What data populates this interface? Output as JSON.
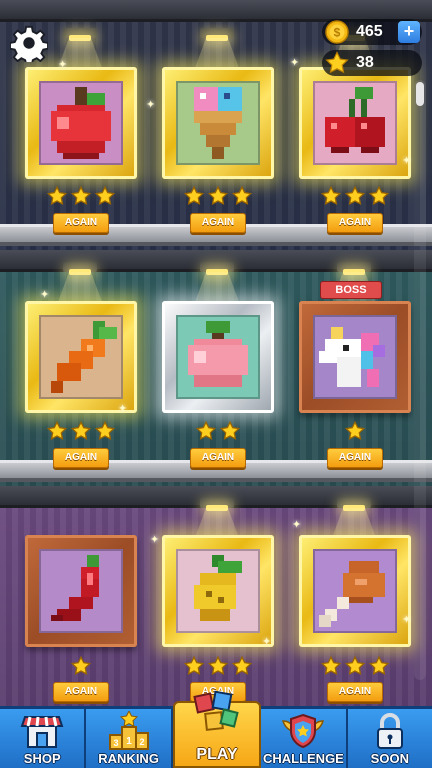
{
  "gallery": {
    "rooms": [
      {
        "name": "room-1",
        "artworks": [
          {
            "subject": "apple",
            "frame": "gold",
            "stars_earned": 3,
            "stars_max": 3,
            "button": "AGAIN",
            "canvas_bg": "#c98fc4"
          },
          {
            "subject": "ice cream",
            "frame": "gold",
            "stars_earned": 3,
            "stars_max": 3,
            "button": "AGAIN",
            "canvas_bg": "#a7c98a"
          },
          {
            "subject": "cherries",
            "frame": "gold",
            "stars_earned": 3,
            "stars_max": 3,
            "button": "AGAIN",
            "canvas_bg": "#e6a9c4"
          }
        ]
      },
      {
        "name": "room-2",
        "artworks": [
          {
            "subject": "carrot",
            "frame": "gold",
            "stars_earned": 3,
            "stars_max": 3,
            "button": "AGAIN",
            "canvas_bg": "#d9b48c"
          },
          {
            "subject": "peach",
            "frame": "silver",
            "stars_earned": 2,
            "stars_max": 2,
            "button": "AGAIN",
            "canvas_bg": "#7ccab6"
          },
          {
            "subject": "unicorn",
            "frame": "wood",
            "stars_earned": 1,
            "stars_max": 1,
            "button": "AGAIN",
            "badge": "BOSS",
            "canvas_bg": "#a586c9"
          }
        ]
      },
      {
        "name": "room-3",
        "artworks": [
          {
            "subject": "chili pepper",
            "frame": "wood",
            "stars_earned": 1,
            "stars_max": 1,
            "button": "AGAIN",
            "canvas_bg": "#b58ac9"
          },
          {
            "subject": "pineapple",
            "frame": "gold",
            "stars_earned": 3,
            "stars_max": 3,
            "button": "AGAIN",
            "canvas_bg": "#e5c1cf"
          },
          {
            "subject": "drumstick",
            "frame": "gold",
            "stars_earned": 3,
            "stars_max": 3,
            "button": "AGAIN",
            "canvas_bg": "#b28ad0"
          }
        ]
      }
    ]
  },
  "hud": {
    "settings_icon": "gear-icon",
    "coins": "465",
    "coin_icon": "dollar-coin-icon",
    "stars_total": "38",
    "star_icon": "star-icon",
    "plus_label": "+"
  },
  "nav": {
    "items": [
      {
        "label": "SHOP",
        "icon": "shop-icon",
        "active": false
      },
      {
        "label": "RANKING",
        "icon": "podium-icon",
        "active": false
      },
      {
        "label": "PLAY",
        "icon": "blocks-icon",
        "active": true
      },
      {
        "label": "CHALLENGE",
        "icon": "shield-wings-icon",
        "active": false
      },
      {
        "label": "SOON",
        "icon": "lock-icon",
        "active": false
      }
    ]
  },
  "colors": {
    "gold": "#f2c415",
    "star": "#ffcf1f",
    "again_button": "#f6a716",
    "nav": "#2a83dc",
    "boss": "#e04b4b"
  }
}
